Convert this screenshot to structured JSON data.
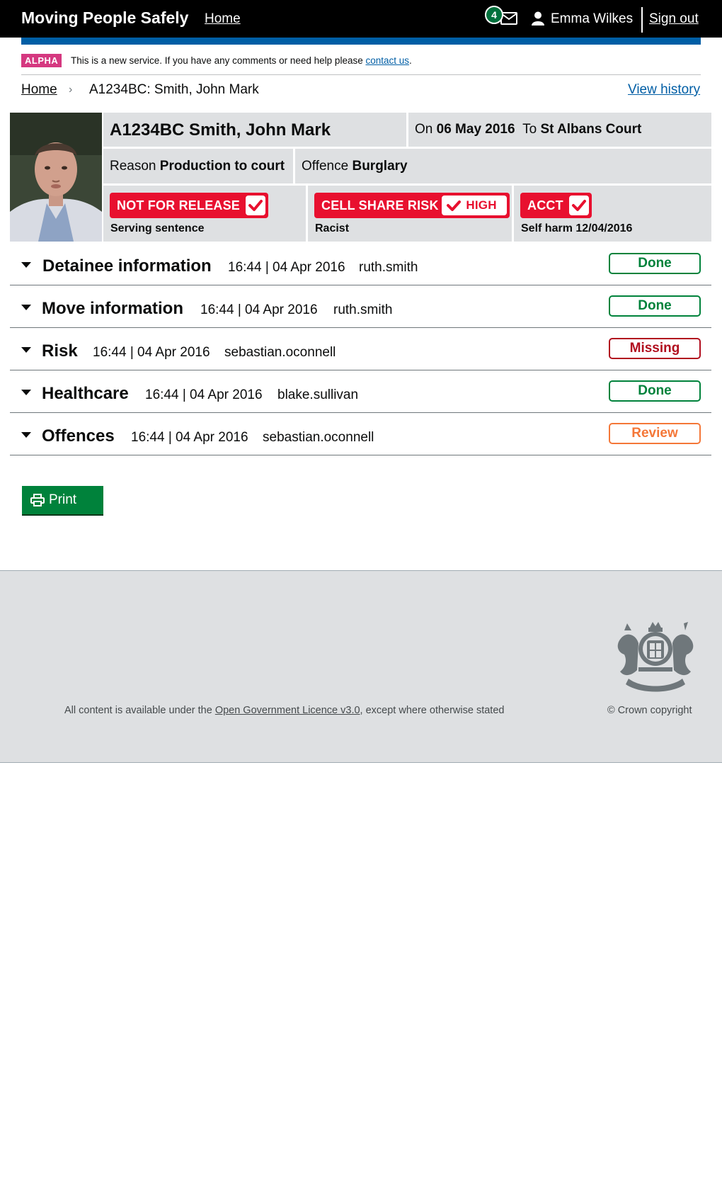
{
  "header": {
    "brand": "Moving People Safely",
    "home_link": "Home",
    "notification_count": "4",
    "user_name": "Emma Wilkes",
    "sign_out": "Sign out"
  },
  "phase_banner": {
    "tag": "ALPHA",
    "text": "This is a new service. If you have any comments or need help please",
    "link": "contact us",
    "suffix": "."
  },
  "breadcrumb": {
    "home": "Home",
    "current": "A1234BC: Smith, John Mark",
    "view_history": "View history"
  },
  "detainee": {
    "name": "A1234BC Smith, John Mark",
    "on_label": "On",
    "date": "06 May 2016",
    "to_label": "To",
    "destination": "St Albans Court",
    "reason_label": "Reason",
    "reason": "Production to court",
    "offence_label": "Offence",
    "offence": "Burglary"
  },
  "alerts": [
    {
      "label": "NOT FOR RELEASE",
      "detail": "Serving sentence"
    },
    {
      "label": "CELL SHARE RISK",
      "level": "HIGH",
      "detail": "Racist"
    },
    {
      "label": "ACCT",
      "detail": "Self harm 12/04/2016"
    }
  ],
  "sections": [
    {
      "title": "Detainee information",
      "time": "16:44 | 04 Apr 2016",
      "user": "ruth.smith",
      "status": "Done"
    },
    {
      "title": "Move information",
      "time": "16:44 | 04 Apr 2016",
      "user": "ruth.smith",
      "status": "Done"
    },
    {
      "title": "Risk",
      "time": "16:44 | 04 Apr 2016",
      "user": "sebastian.oconnell",
      "status": "Missing"
    },
    {
      "title": "Healthcare",
      "time": "16:44 | 04 Apr 2016",
      "user": "blake.sullivan",
      "status": "Done"
    },
    {
      "title": "Offences",
      "time": "16:44 | 04 Apr 2016",
      "user": "sebastian.oconnell",
      "status": "Review"
    }
  ],
  "print_button": "Print",
  "footer": {
    "licence_prefix": "All content is available under the",
    "licence_link": "Open Government Licence v3.0",
    "licence_suffix": ", except where otherwise stated",
    "copyright": "© Crown copyright"
  },
  "colors": {
    "header_bg": "#000000",
    "blue_bar": "#005ea5",
    "alpha_tag": "#d53880",
    "alert_red": "#e8102f",
    "done_green": "#00823b",
    "missing_red": "#b10e1e",
    "review_orange": "#f47738",
    "panel_grey": "#dee0e2"
  },
  "icons": [
    "mail-icon",
    "user-icon",
    "tick-icon",
    "caret-down-icon",
    "printer-icon",
    "royal-crest"
  ]
}
